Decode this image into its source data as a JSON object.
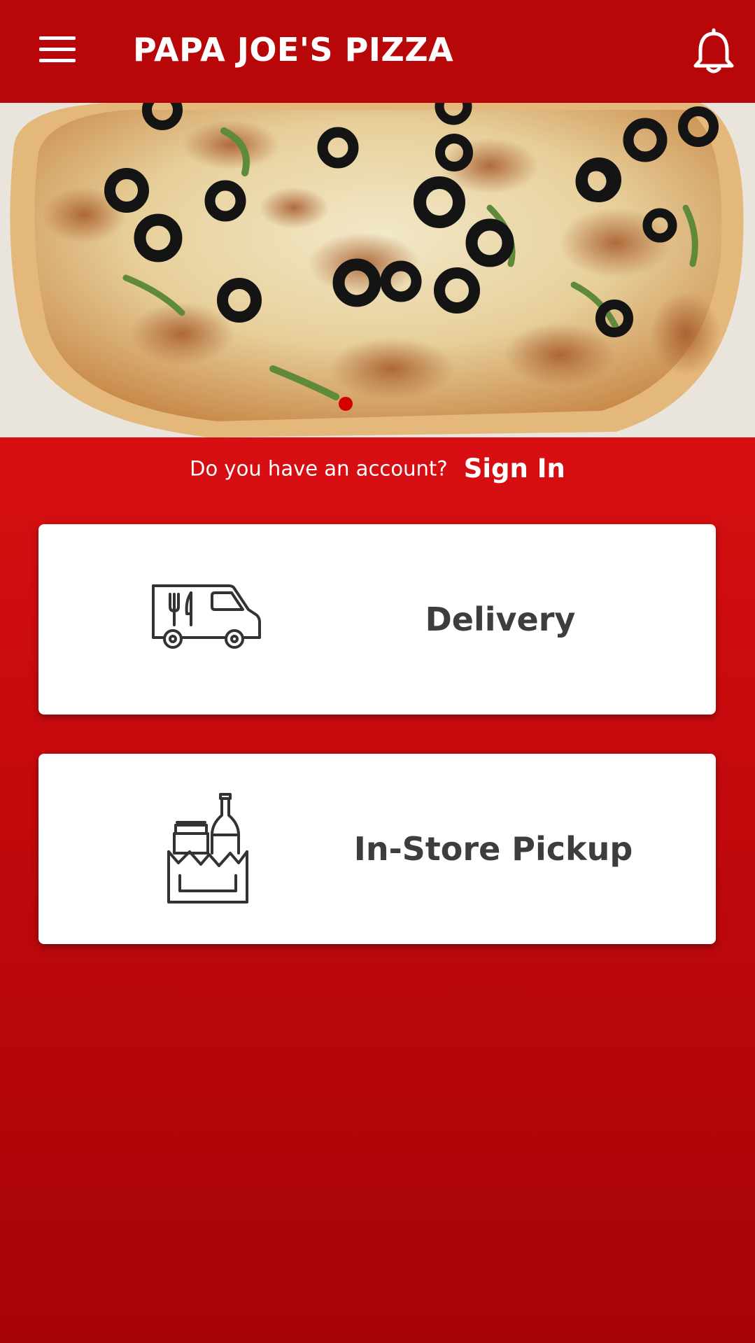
{
  "app": {
    "title": "PAPA JOE'S PIZZA",
    "brand_color": "#b80709",
    "background_color": "#d10e11"
  },
  "header": {
    "menu_icon": "hamburger-menu-icon",
    "notification_icon": "bell-icon"
  },
  "hero": {
    "image": "pizza-photo",
    "carousel_indicator_color": "#d40000"
  },
  "account": {
    "question": "Do you have an account?",
    "sign_in_label": "Sign In"
  },
  "order_options": [
    {
      "label": "Delivery",
      "icon": "delivery-truck-icon"
    },
    {
      "label": "In-Store Pickup",
      "icon": "grocery-bag-icon"
    }
  ]
}
